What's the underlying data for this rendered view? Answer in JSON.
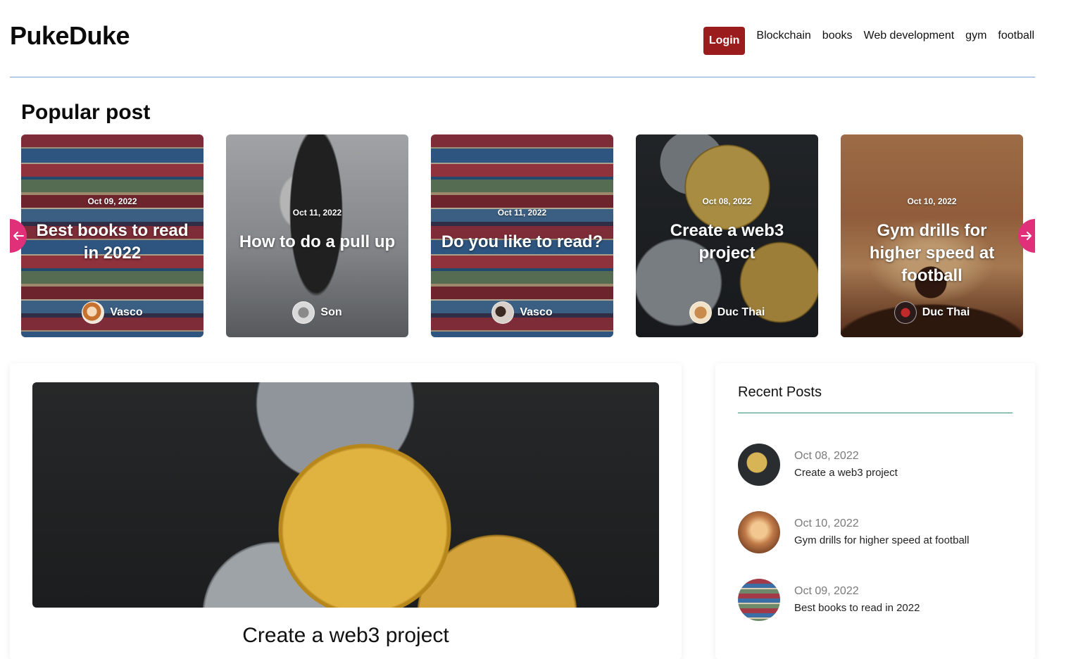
{
  "header": {
    "brand": "PukeDuke",
    "login_label": "Login",
    "nav": [
      "Blockchain",
      "books",
      "Web development",
      "gym",
      "football"
    ]
  },
  "popular": {
    "title": "Popular post",
    "prev_icon": "arrow-left-icon",
    "next_icon": "arrow-right-icon",
    "cards": [
      {
        "date": "Oct 09, 2022",
        "title": "Best books to read in 2022",
        "author": "Vasco"
      },
      {
        "date": "Oct 11, 2022",
        "title": "How to do a pull up",
        "author": "Son"
      },
      {
        "date": "Oct 11, 2022",
        "title": "Do you like to read?",
        "author": "Vasco"
      },
      {
        "date": "Oct 08, 2022",
        "title": "Create a web3 project",
        "author": "Duc Thai"
      },
      {
        "date": "Oct 10, 2022",
        "title": "Gym drills for higher speed at football",
        "author": "Duc Thai"
      }
    ]
  },
  "main": {
    "title": "Create a web3 project"
  },
  "sidebar": {
    "title": "Recent Posts",
    "items": [
      {
        "date": "Oct 08, 2022",
        "title": "Create a web3 project"
      },
      {
        "date": "Oct 10, 2022",
        "title": "Gym drills for higher speed at football"
      },
      {
        "date": "Oct 09, 2022",
        "title": "Best books to read in 2022"
      }
    ]
  },
  "colors": {
    "login_bg": "#9b1c1c",
    "arrow_bg": "#e0307a",
    "header_rule": "#7f9fe0",
    "sidebar_rule": "#2f8f7f"
  }
}
